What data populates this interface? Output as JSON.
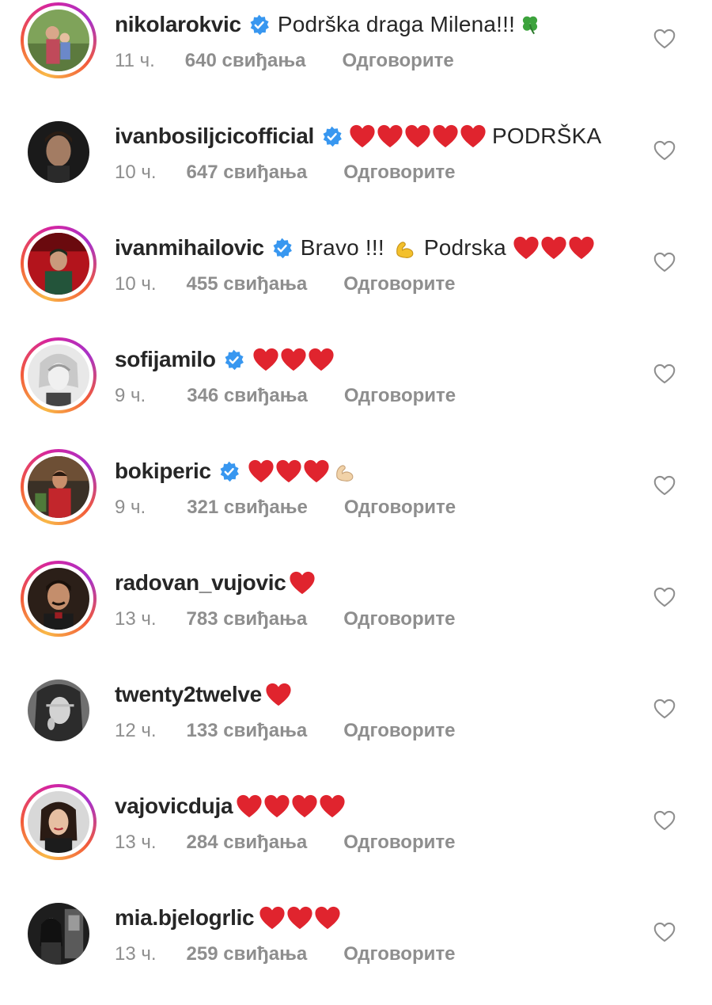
{
  "colors": {
    "text": "#262626",
    "meta": "#8e8e8e",
    "verified_badge": "#3897f0",
    "heart": "#e0242e"
  },
  "comments": [
    {
      "username": "nikolarokvic",
      "verified": true,
      "text": "Podrška draga Milena!!!",
      "emoji": [
        "four-leaf-clover"
      ],
      "time": "11 ч.",
      "likes": "640 свиђања",
      "reply": "Одговорите",
      "story_ring": true
    },
    {
      "username": "ivanbosiljcicofficial",
      "verified": true,
      "emoji_before_text": [
        "red-heart",
        "red-heart",
        "red-heart",
        "red-heart",
        "red-heart"
      ],
      "text": "PODRŠKA",
      "time": "10 ч.",
      "likes": "647 свиђања",
      "reply": "Одговорите",
      "story_ring": false
    },
    {
      "username": "ivanmihailovic",
      "verified": true,
      "text": "Bravo !!!",
      "emoji_mid": [
        "flexed-biceps"
      ],
      "text2": "Podrska",
      "emoji": [
        "red-heart",
        "red-heart",
        "red-heart"
      ],
      "time": "10 ч.",
      "likes": "455 свиђања",
      "reply": "Одговорите",
      "story_ring": true
    },
    {
      "username": "sofijamilo",
      "verified": true,
      "emoji": [
        "red-heart",
        "red-heart",
        "red-heart"
      ],
      "time": "9 ч.",
      "likes": "346 свиђања",
      "reply": "Одговорите",
      "story_ring": true
    },
    {
      "username": "bokiperic",
      "verified": true,
      "emoji": [
        "red-heart",
        "red-heart",
        "red-heart",
        "flexed-biceps"
      ],
      "time": "9 ч.",
      "likes": "321 свиђање",
      "reply": "Одговорите",
      "story_ring": true
    },
    {
      "username": "radovan_vujovic",
      "verified": false,
      "emoji": [
        "red-heart"
      ],
      "time": "13 ч.",
      "likes": "783 свиђања",
      "reply": "Одговорите",
      "story_ring": true
    },
    {
      "username": "twenty2twelve",
      "verified": false,
      "emoji": [
        "red-heart"
      ],
      "time": "12 ч.",
      "likes": "133 свиђања",
      "reply": "Одговорите",
      "story_ring": false
    },
    {
      "username": "vajovicduja",
      "verified": false,
      "emoji": [
        "red-heart",
        "red-heart",
        "red-heart",
        "red-heart"
      ],
      "time": "13 ч.",
      "likes": "284 свиђања",
      "reply": "Одговорите",
      "story_ring": true
    },
    {
      "username": "mia.bjelogrlic",
      "verified": false,
      "emoji": [
        "red-heart",
        "red-heart",
        "red-heart"
      ],
      "time": "13 ч.",
      "likes": "259 свиђања",
      "reply": "Одговорите",
      "story_ring": false
    }
  ]
}
